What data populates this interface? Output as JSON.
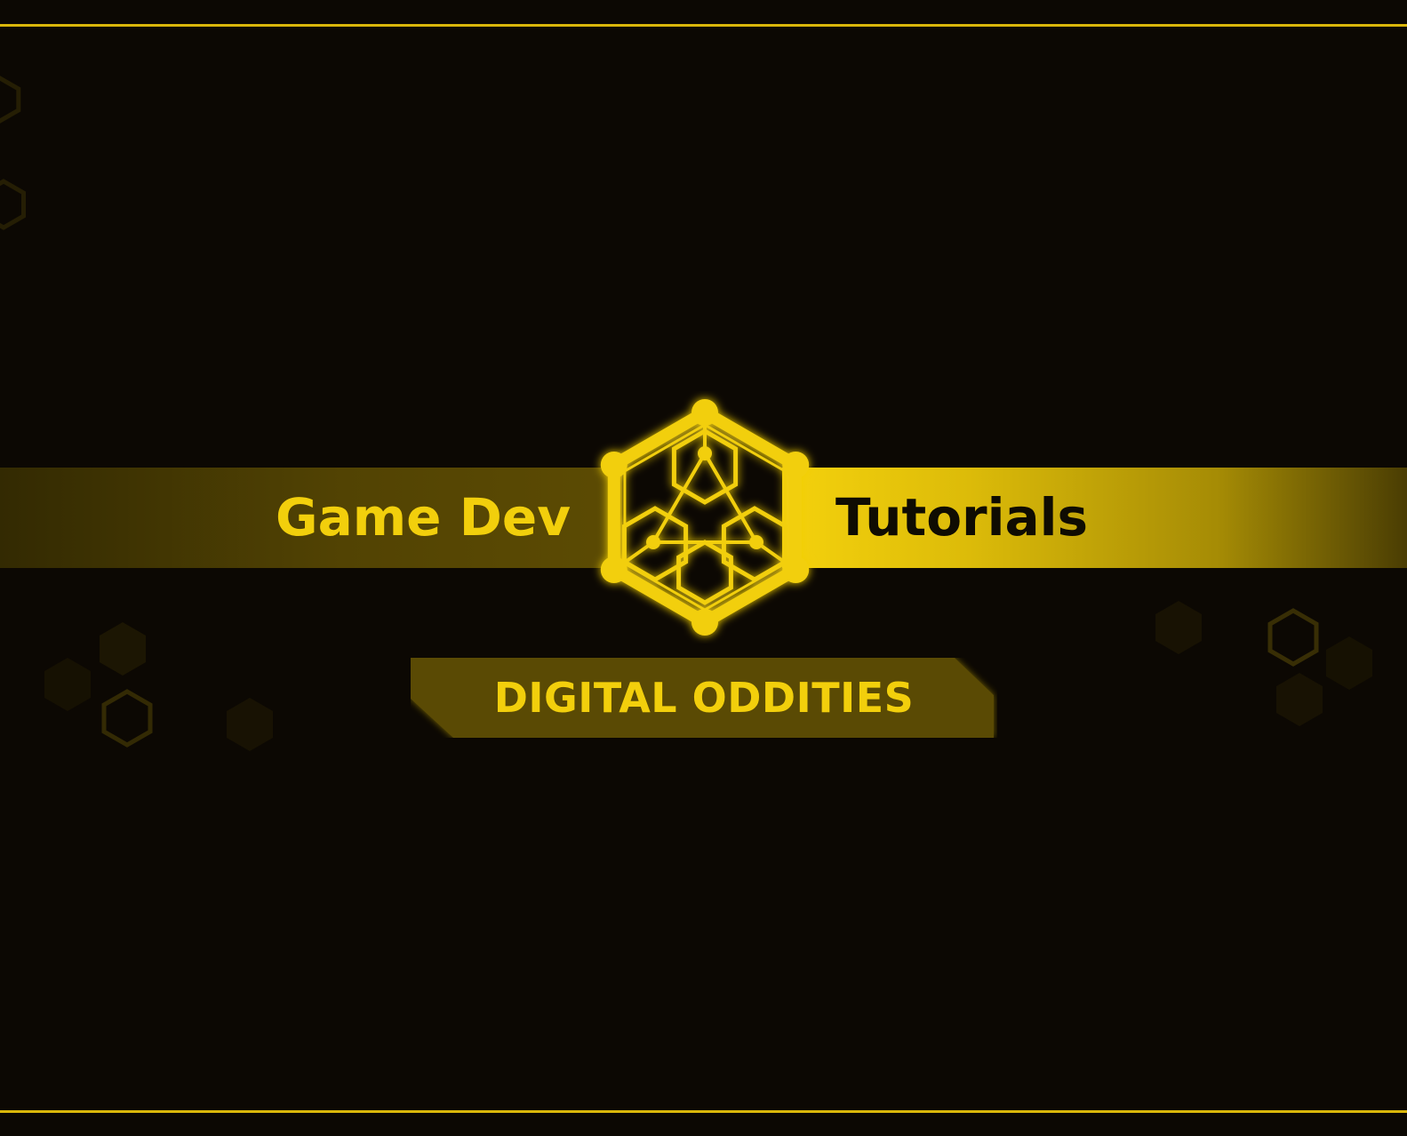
{
  "banner": {
    "left_text": "Game Dev",
    "right_text": "Tutorials"
  },
  "subtitle": {
    "text": "DIGITAL ODDITIES"
  },
  "logo": {
    "icon": "hexagon-network-icon"
  },
  "colors": {
    "background": "#0c0803",
    "accent": "#f2cf0c",
    "text_dark": "#0f0c02",
    "frame_line": "#d9b60a",
    "subtitle_fill": "#5a4a04",
    "hex_dim": "#2a2304"
  }
}
